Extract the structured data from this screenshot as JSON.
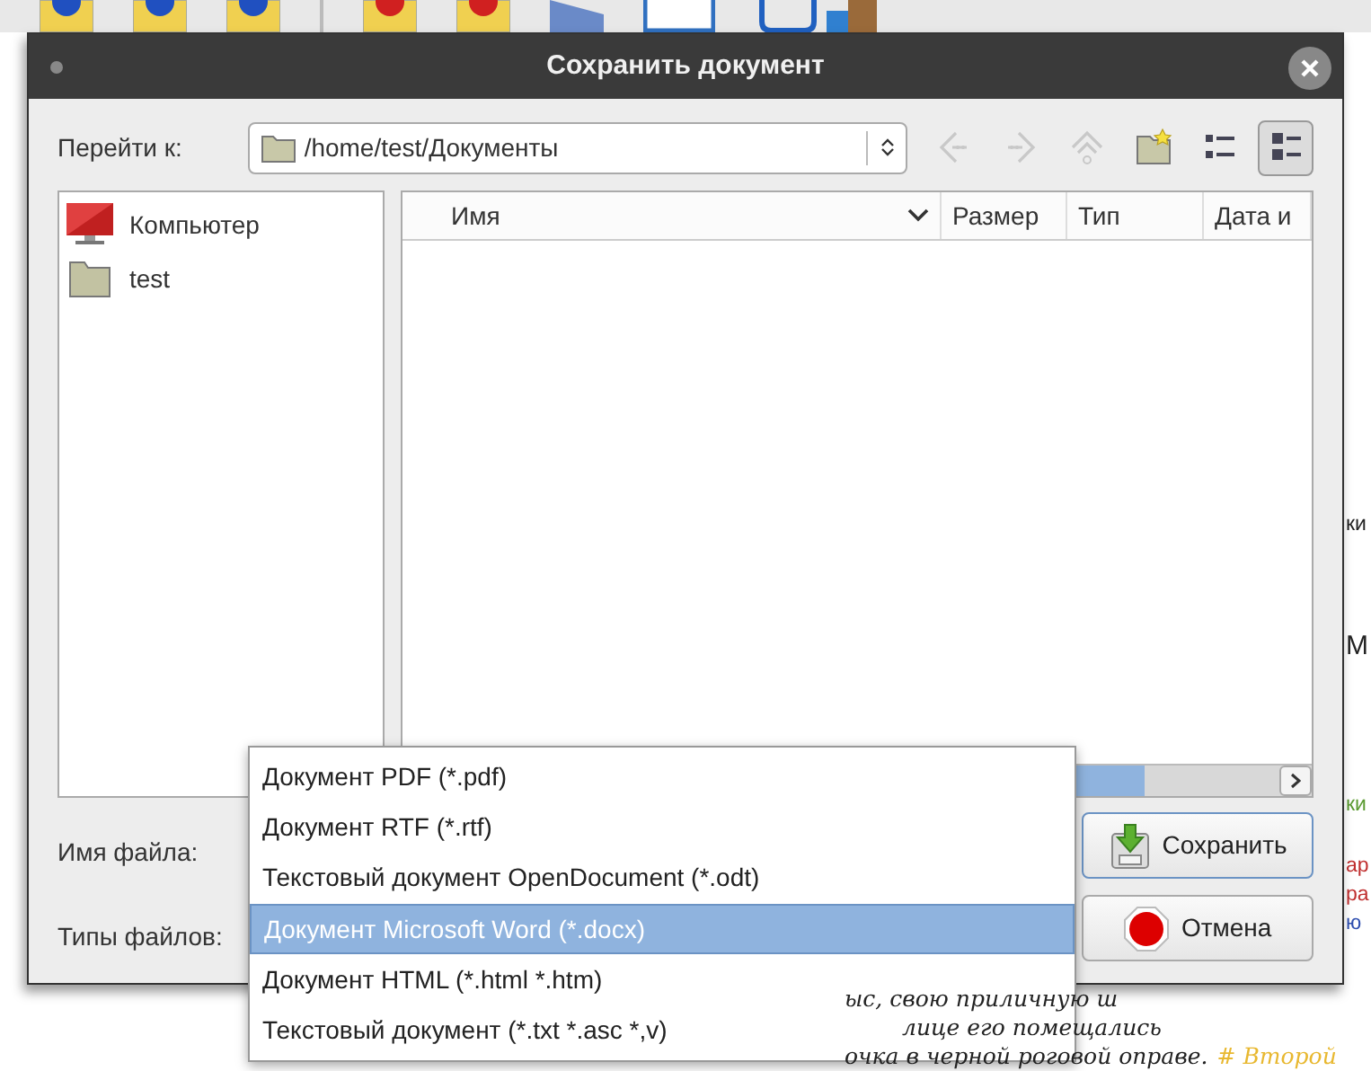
{
  "dialog": {
    "title": "Сохранить документ",
    "location_label": "Перейти к:",
    "location_path": "/home/test/Документы",
    "nav_buttons": [
      {
        "kind": "back",
        "disabled": true
      },
      {
        "kind": "forward",
        "disabled": true
      },
      {
        "kind": "up",
        "disabled": true
      },
      {
        "kind": "new-folder",
        "disabled": false
      },
      {
        "kind": "list-view",
        "selected": false
      },
      {
        "kind": "detail-view",
        "selected": true
      }
    ],
    "places": [
      {
        "label": "Компьютер",
        "kind": "computer"
      },
      {
        "label": "test",
        "kind": "folder"
      }
    ],
    "columns": [
      {
        "label": "Имя",
        "sorted": true
      },
      {
        "label": "Размер",
        "sorted": false
      },
      {
        "label": "Тип",
        "sorted": false
      },
      {
        "label": "Дата и",
        "sorted": false
      }
    ],
    "filename_label": "Имя файла:",
    "filetype_label": "Типы файлов:",
    "buttons": [
      {
        "label": "Сохранить",
        "kind": "save",
        "focused": true
      },
      {
        "label": "Отмена",
        "kind": "cancel",
        "focused": false
      }
    ],
    "file_types": [
      {
        "label": "Документ PDF (*.pdf)",
        "selected": false
      },
      {
        "label": "Документ RTF (*.rtf)",
        "selected": false
      },
      {
        "label": "Текстовый документ OpenDocument (*.odt)",
        "selected": false
      },
      {
        "label": "Документ Microsoft Word (*.docx)",
        "selected": true
      },
      {
        "label": "Документ HTML (*.html *.htm)",
        "selected": false
      },
      {
        "label": "Текстовый документ (*.txt *.asc *,v)",
        "selected": false
      }
    ]
  },
  "background_document": {
    "edge_fragments": [
      {
        "text": "ки",
        "color": "#222222"
      },
      {
        "text": "М",
        "color": "#222222"
      },
      {
        "text": "ки",
        "color": "#5a9a30"
      },
      {
        "text": "ар",
        "color": "#c03030"
      },
      {
        "text": "ра",
        "color": "#c03030"
      },
      {
        "text": "ю",
        "color": "#3050b0"
      }
    ],
    "lines": [
      [
        {
          "text": "ыс, свою приличную ш",
          "color": "#222222"
        }
      ],
      [
        {
          "text": "лице его помещались",
          "color": "#222222"
        }
      ],
      [
        {
          "text": "очка в черной роговой оправе.",
          "color": "#222222"
        },
        {
          "text": "# Второй",
          "color": "#e8b830"
        }
      ]
    ]
  }
}
